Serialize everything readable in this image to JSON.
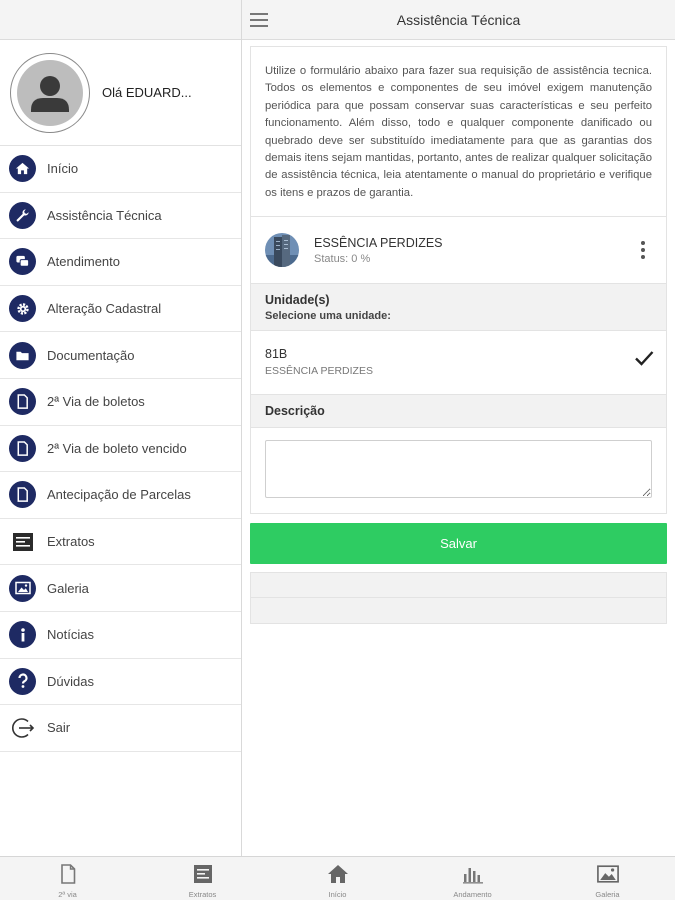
{
  "header": {
    "title": "Assistência Técnica"
  },
  "sidebar": {
    "greeting": "Olá EDUARD...",
    "items": [
      {
        "label": "Início",
        "icon": "home-icon"
      },
      {
        "label": "Assistência Técnica",
        "icon": "wrench-icon"
      },
      {
        "label": "Atendimento",
        "icon": "chat-icon"
      },
      {
        "label": "Alteração Cadastral",
        "icon": "gear-icon"
      },
      {
        "label": "Documentação",
        "icon": "folder-icon"
      },
      {
        "label": "2ª Via de boletos",
        "icon": "document-icon"
      },
      {
        "label": "2ª Via de boleto vencido",
        "icon": "document-icon"
      },
      {
        "label": "Antecipação de Parcelas",
        "icon": "document-icon"
      },
      {
        "label": "Extratos",
        "icon": "statement-icon"
      },
      {
        "label": "Galeria",
        "icon": "gallery-icon"
      },
      {
        "label": "Notícias",
        "icon": "info-icon"
      },
      {
        "label": "Dúvidas",
        "icon": "question-icon"
      },
      {
        "label": "Sair",
        "icon": "logout-icon"
      }
    ]
  },
  "main": {
    "intro": "Utilize o formulário abaixo para fazer sua requisição de assistência tecnica. Todos os elementos e componentes de seu imóvel exigem manutenção periódica para que possam conservar suas características e seu perfeito funcionamento. Além disso, todo e qualquer componente danificado ou quebrado deve ser substituído imediatamente para que as garantias dos demais itens sejam mantidas, portanto, antes de realizar qualquer solicitação de assistência técnica, leia atentamente o manual do proprietário e verifique os itens e prazos de garantia.",
    "project": {
      "name": "ESSÊNCIA PERDIZES",
      "status": "Status: 0 %"
    },
    "units_title": "Unidade(s)",
    "units_subtitle": "Selecione uma unidade:",
    "unit": {
      "code": "81B",
      "project": "ESSÊNCIA PERDIZES",
      "selected": true
    },
    "description_title": "Descrição",
    "description_value": "",
    "save_label": "Salvar"
  },
  "tabbar": {
    "items": [
      {
        "label": "2ª via",
        "icon": "document-icon"
      },
      {
        "label": "Extratos",
        "icon": "statement-icon"
      },
      {
        "label": "Início",
        "icon": "home-icon"
      },
      {
        "label": "Andamento",
        "icon": "chart-icon"
      },
      {
        "label": "Galeria",
        "icon": "gallery-icon"
      }
    ]
  },
  "colors": {
    "accent": "#1e2a63",
    "save_button": "#2ecc62",
    "bar_background": "#f4f4f4",
    "section_background": "#f2f2f2"
  }
}
